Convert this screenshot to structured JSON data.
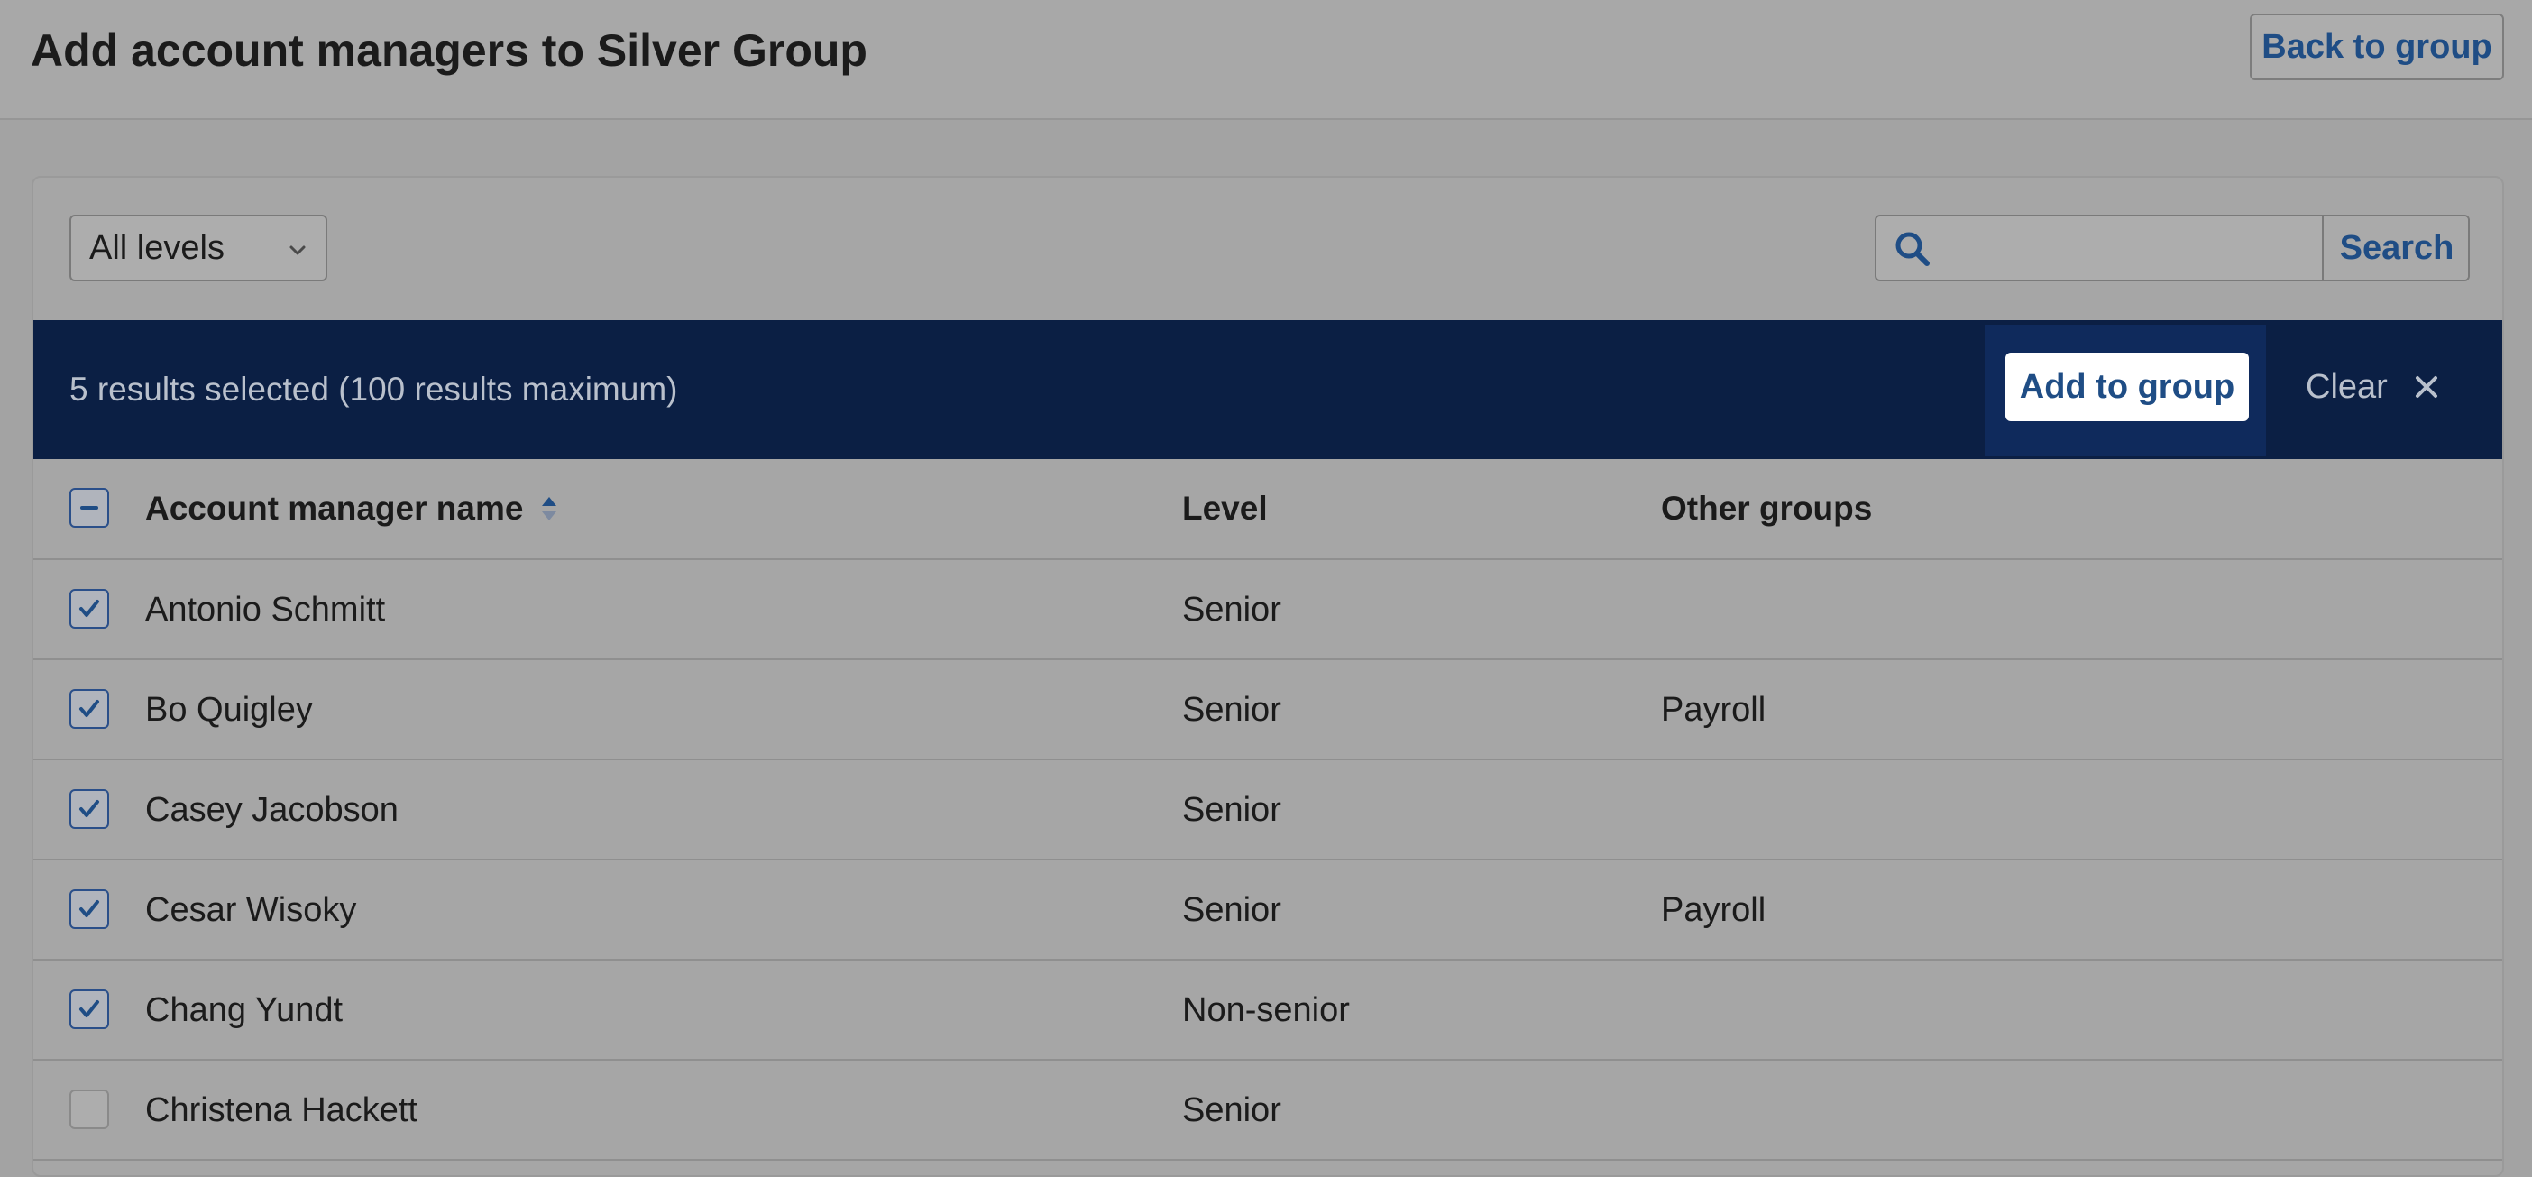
{
  "header": {
    "title": "Add account managers to Silver Group",
    "back_label": "Back to group"
  },
  "filters": {
    "level_select": "All levels",
    "search_placeholder": "",
    "search_label": "Search"
  },
  "selection_bar": {
    "text": "5 results selected (100 results maximum)",
    "add_label": "Add to group",
    "clear_label": "Clear"
  },
  "table": {
    "columns": [
      "Account manager name",
      "Level",
      "Other groups"
    ],
    "sort": {
      "column": "Account manager name",
      "direction": "ascending"
    },
    "rows": [
      {
        "name": "Antonio Schmitt",
        "level": "Senior",
        "groups": "",
        "checked": true
      },
      {
        "name": "Bo Quigley",
        "level": "Senior",
        "groups": "Payroll",
        "checked": true
      },
      {
        "name": "Casey Jacobson",
        "level": "Senior",
        "groups": "",
        "checked": true
      },
      {
        "name": "Cesar Wisoky",
        "level": "Senior",
        "groups": "Payroll",
        "checked": true
      },
      {
        "name": "Chang Yundt",
        "level": "Non-senior",
        "groups": "",
        "checked": true
      },
      {
        "name": "Christena Hackett",
        "level": "Senior",
        "groups": "",
        "checked": false
      }
    ]
  },
  "icons": {
    "search": "search-icon",
    "chevron": "chevron-down-icon",
    "close": "close-icon",
    "sort": "sort-icon",
    "checkbox": "checkmark-icon",
    "select_all": "indeterminate-checkbox-icon"
  },
  "colors": {
    "accent": "#1f4d85",
    "selection_bar": "#0b1f44",
    "overlay_bg": "#a3a3a3"
  }
}
